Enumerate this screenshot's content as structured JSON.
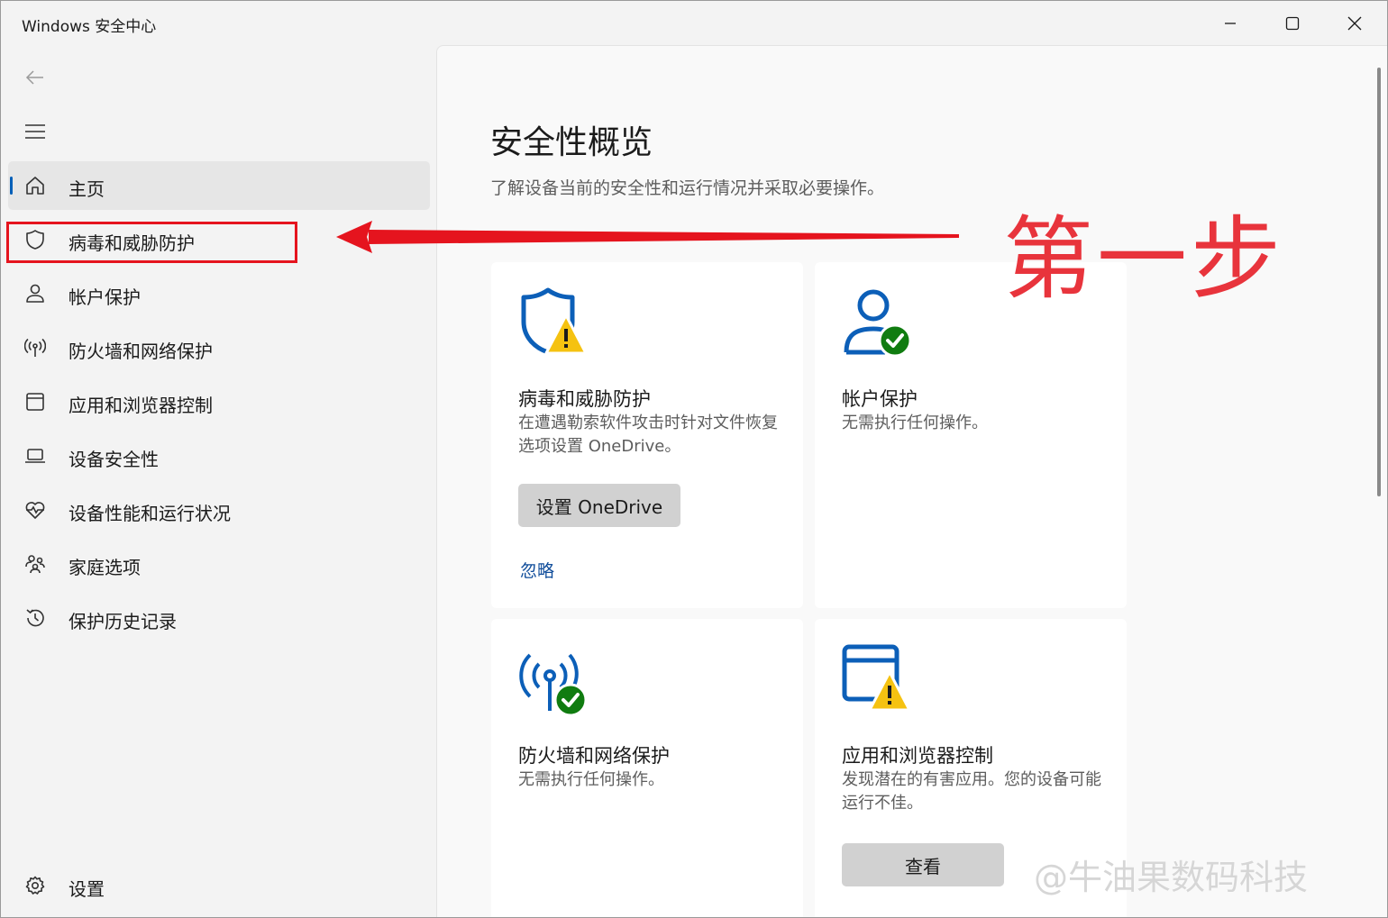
{
  "window": {
    "title": "Windows 安全中心",
    "controls": [
      "minimize-icon",
      "maximize-icon",
      "close-icon"
    ]
  },
  "sidebar": {
    "back_icon": "arrow-left-icon",
    "menu_icon": "hamburger-icon",
    "items": [
      {
        "label": "主页",
        "icon": "home-icon",
        "active": true
      },
      {
        "label": "病毒和威胁防护",
        "icon": "shield-icon"
      },
      {
        "label": "帐户保护",
        "icon": "person-icon"
      },
      {
        "label": "防火墙和网络保护",
        "icon": "antenna-icon"
      },
      {
        "label": "应用和浏览器控制",
        "icon": "app-window-icon"
      },
      {
        "label": "设备安全性",
        "icon": "laptop-icon"
      },
      {
        "label": "设备性能和运行状况",
        "icon": "heart-pulse-icon"
      },
      {
        "label": "家庭选项",
        "icon": "family-icon"
      },
      {
        "label": "保护历史记录",
        "icon": "history-icon"
      }
    ],
    "settings": {
      "label": "设置",
      "icon": "gear-icon"
    }
  },
  "main": {
    "title": "安全性概览",
    "subtitle": "了解设备当前的安全性和运行情况并采取必要操作。",
    "cards": [
      {
        "title": "病毒和威胁防护",
        "description": "在遭遇勒索软件攻击时针对文件恢复选项设置 OneDrive。",
        "status": "warning",
        "button": "设置 OneDrive",
        "link": "忽略"
      },
      {
        "title": "帐户保护",
        "description": "无需执行任何操作。",
        "status": "ok"
      },
      {
        "title": "防火墙和网络保护",
        "description": "无需执行任何操作。",
        "status": "ok"
      },
      {
        "title": "应用和浏览器控制",
        "description": "发现潜在的有害应用。您的设备可能运行不佳。",
        "status": "warning",
        "button": "查看"
      }
    ]
  },
  "annotation": {
    "step_text": "第一步",
    "color": "#e8343c"
  },
  "watermark": "@牛油果数码科技",
  "colors": {
    "accent": "#005fb8",
    "icon_blue": "#0c5fb8",
    "warning_yellow": "#f5c211",
    "ok_green": "#107c10",
    "link": "#0f4c9a"
  }
}
